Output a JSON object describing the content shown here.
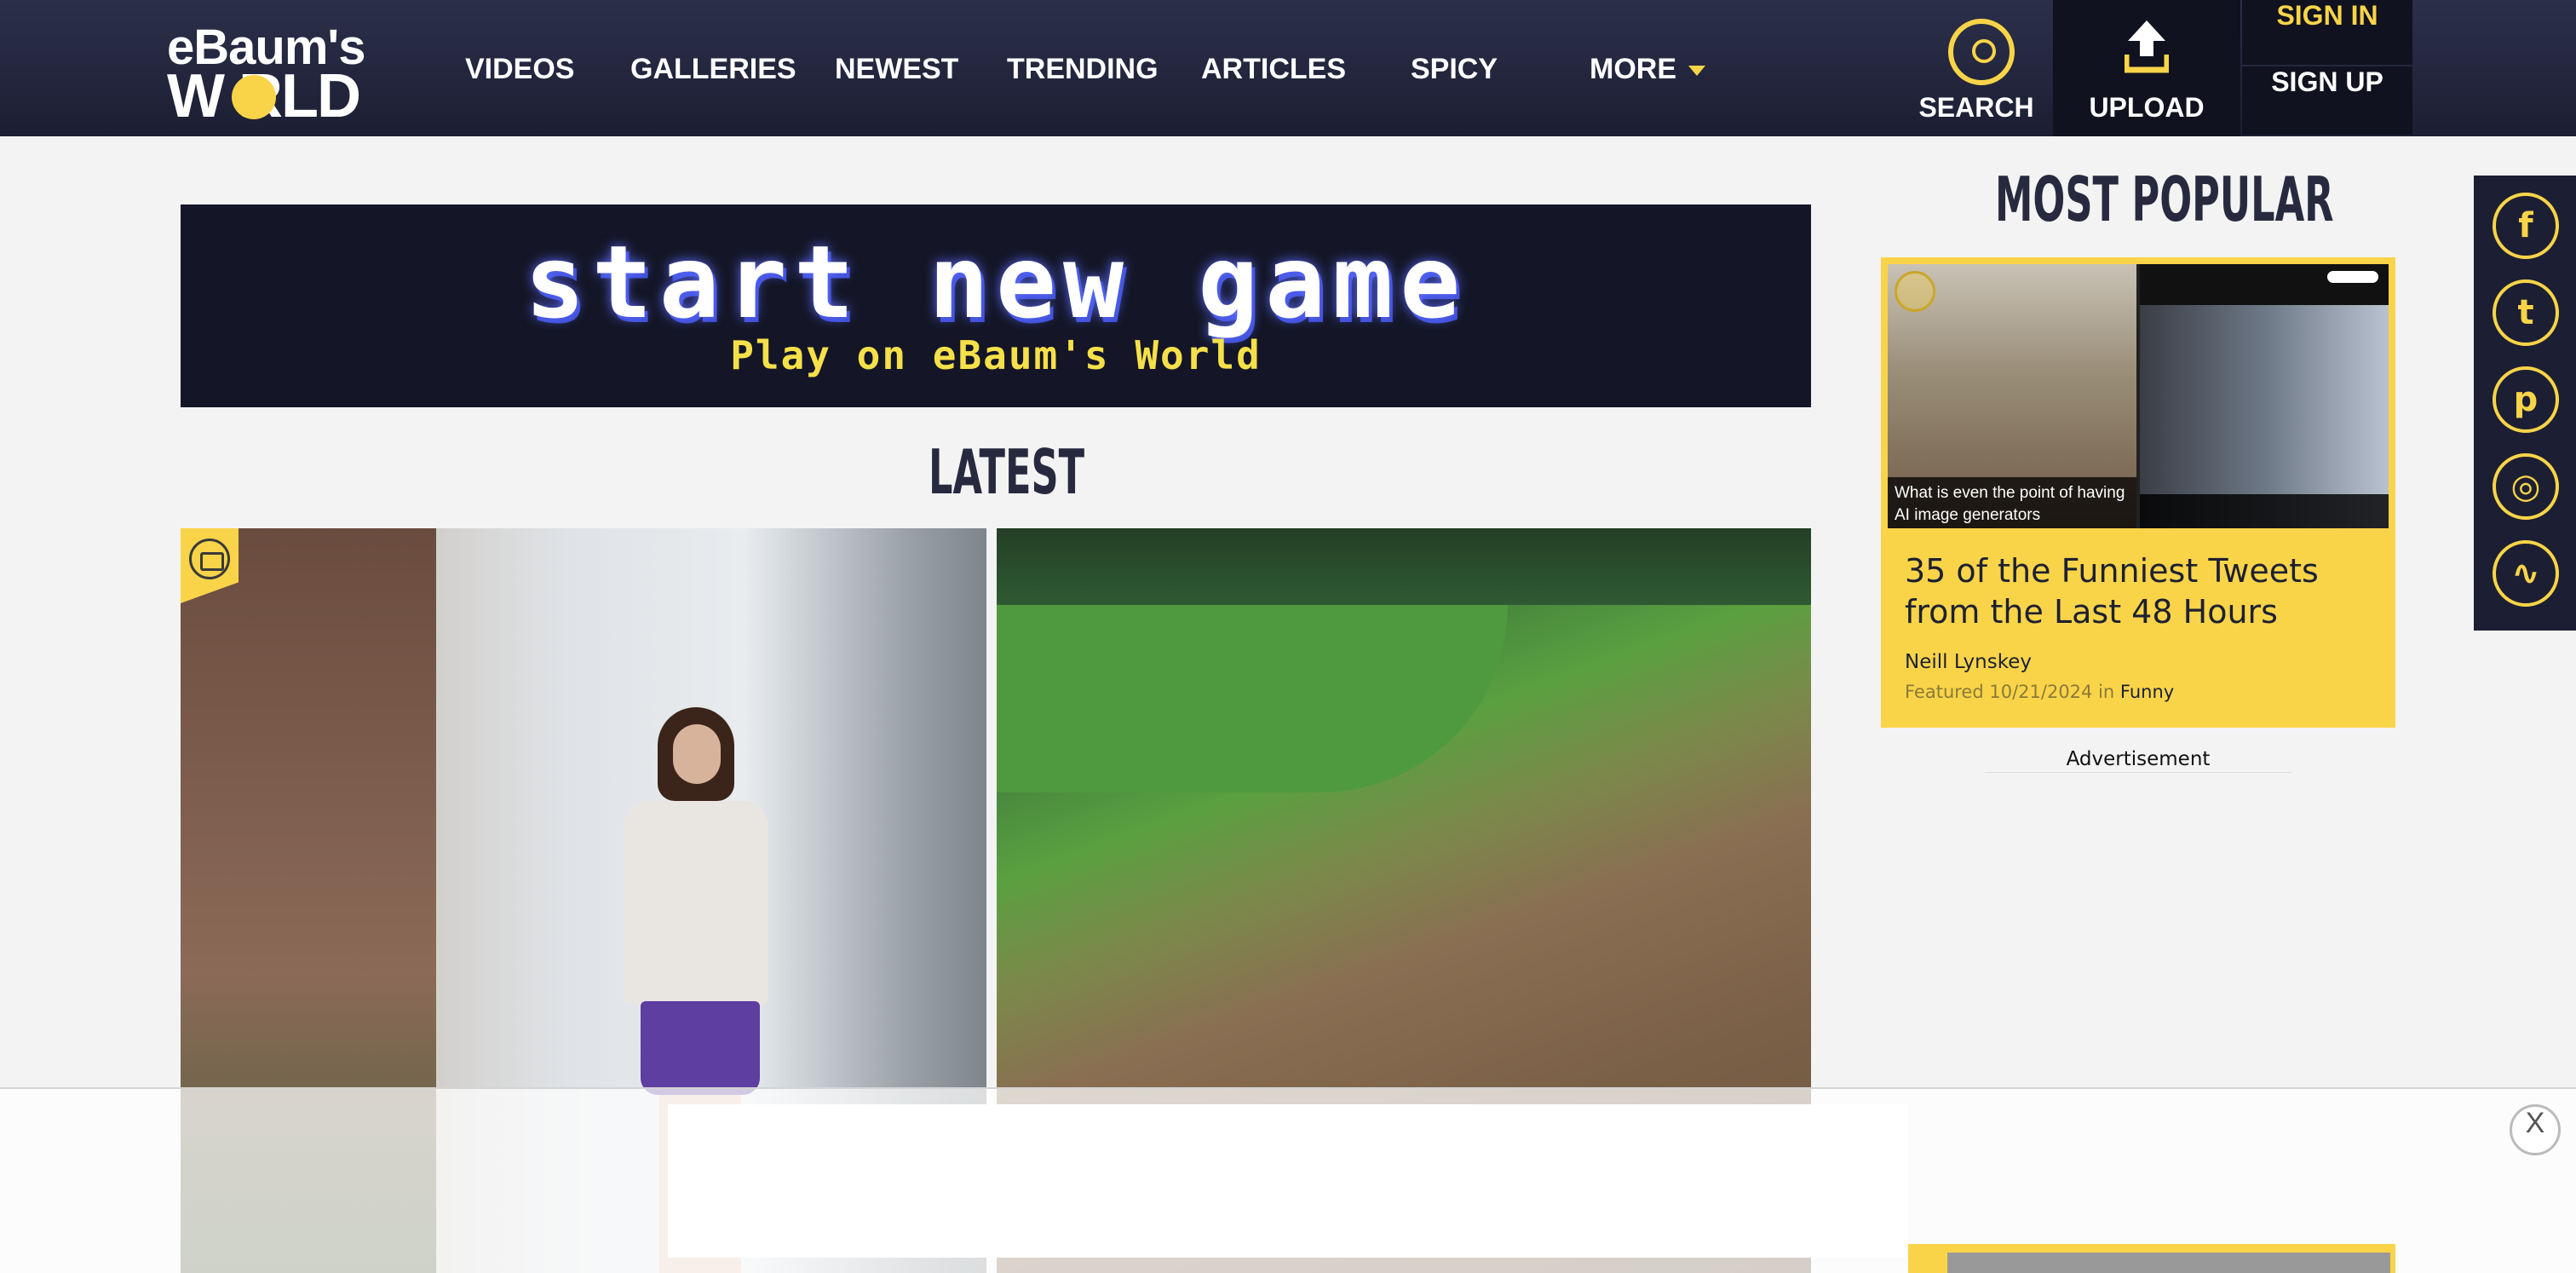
{
  "brand": {
    "logo_line1": "eBaum's",
    "logo_line2": "W  RLD"
  },
  "nav": {
    "items": [
      "VIDEOS",
      "GALLERIES",
      "NEWEST",
      "TRENDING",
      "ARTICLES",
      "SPICY",
      "MORE"
    ],
    "search_label": "SEARCH",
    "upload_label": "UPLOAD",
    "sign_in": "SIGN IN",
    "sign_up": "SIGN UP"
  },
  "banner": {
    "headline": "start new game",
    "subline": "Play on eBaum's World"
  },
  "latest": {
    "title": "LATEST"
  },
  "popular": {
    "title": "MOST POPULAR",
    "card": {
      "image_caption": "What is even the point of having AI image generators",
      "title": "35 of the Funniest Tweets from the Last 48 Hours",
      "author": "Neill Lynskey",
      "meta_prefix": "Featured 10/21/2024 in",
      "category": "Funny"
    }
  },
  "ad": {
    "label": "Advertisement",
    "close": "X"
  },
  "social": {
    "icons": [
      "facebook-icon",
      "twitter-icon",
      "pinterest-icon",
      "instagram-icon",
      "rss-icon"
    ]
  },
  "colors": {
    "nav_bg": "#1c1f33",
    "accent": "#f9d448",
    "page_bg": "#f3f3f3"
  }
}
